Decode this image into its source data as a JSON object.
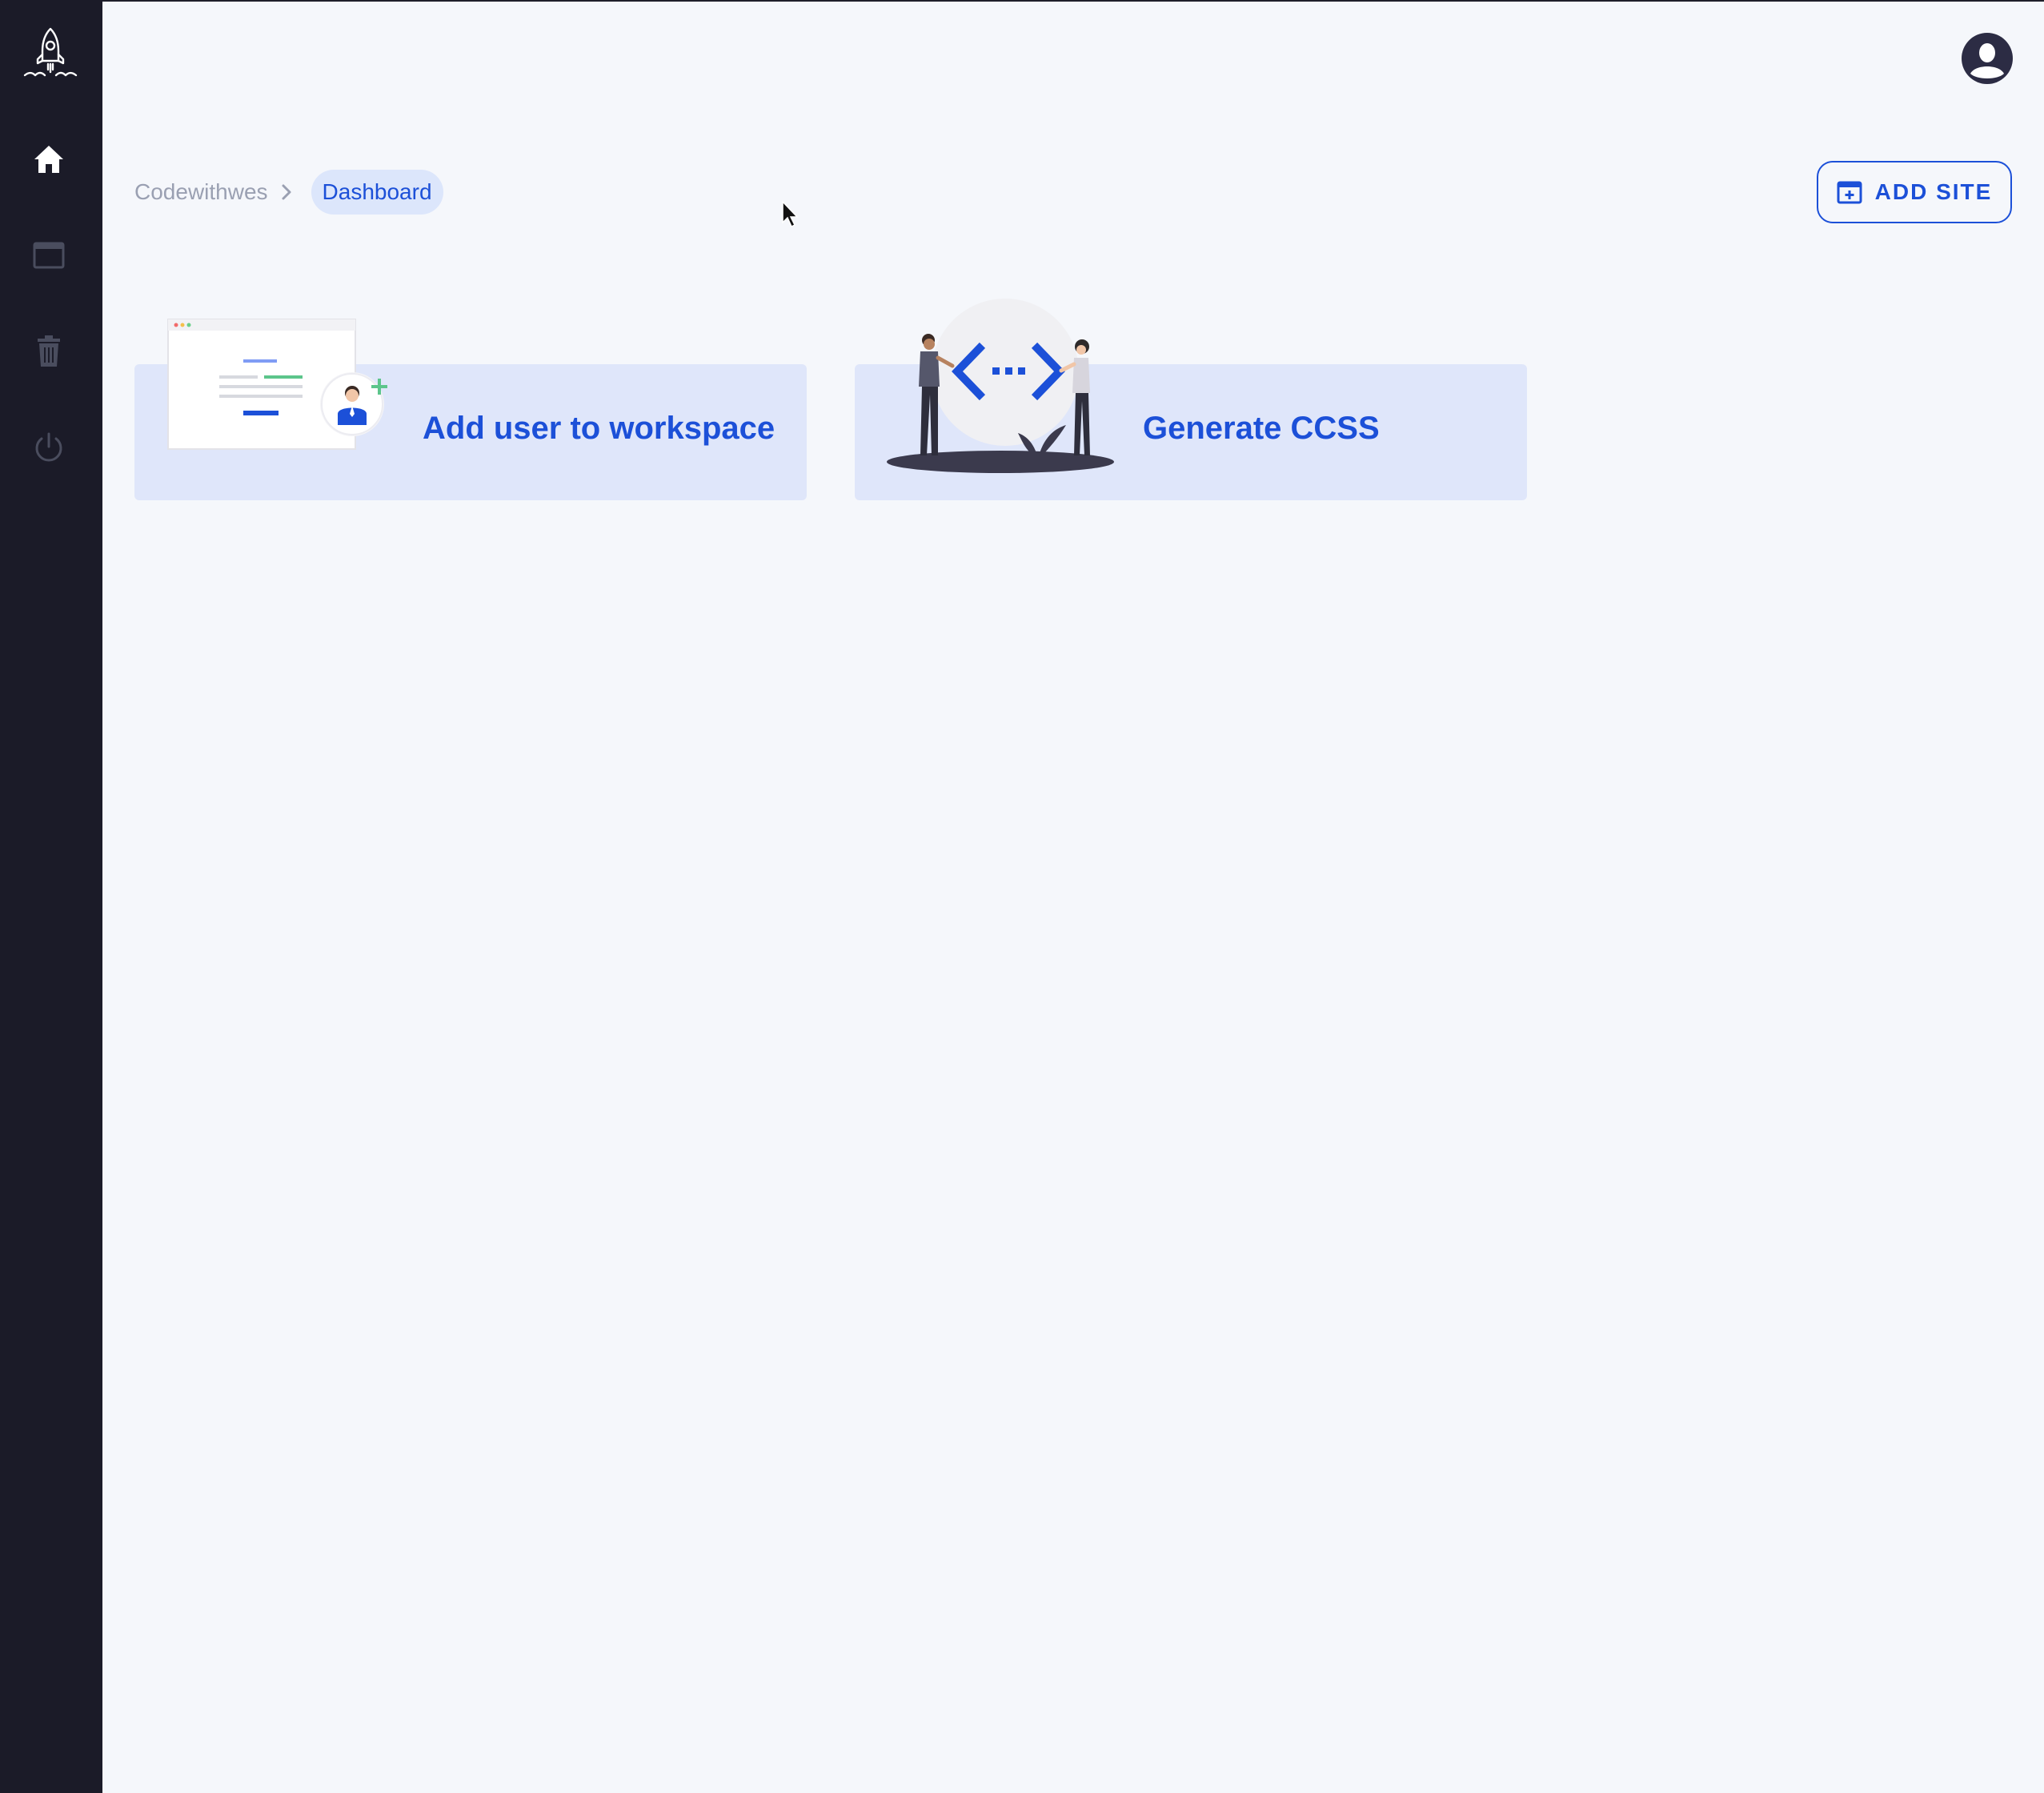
{
  "sidebar": {
    "logo_icon": "rocket-icon",
    "items": [
      {
        "name": "home",
        "icon": "home-icon",
        "active": true
      },
      {
        "name": "sites",
        "icon": "window-icon",
        "active": false
      },
      {
        "name": "trash",
        "icon": "trash-icon",
        "active": false
      },
      {
        "name": "logout",
        "icon": "power-icon",
        "active": false
      }
    ]
  },
  "header": {
    "avatar_icon": "user-avatar-icon"
  },
  "breadcrumb": {
    "root": "Codewithwes",
    "current": "Dashboard"
  },
  "toolbar": {
    "add_site_label": "ADD SITE"
  },
  "cards": [
    {
      "title": "Add user to workspace",
      "illustration": "add-user-illustration"
    },
    {
      "title": "Generate CCSS",
      "illustration": "code-collaboration-illustration"
    }
  ],
  "colors": {
    "sidebar_bg": "#1b1b28",
    "page_bg": "#f5f7fb",
    "accent": "#1c50d8",
    "card_bg": "#dfe6fa"
  }
}
